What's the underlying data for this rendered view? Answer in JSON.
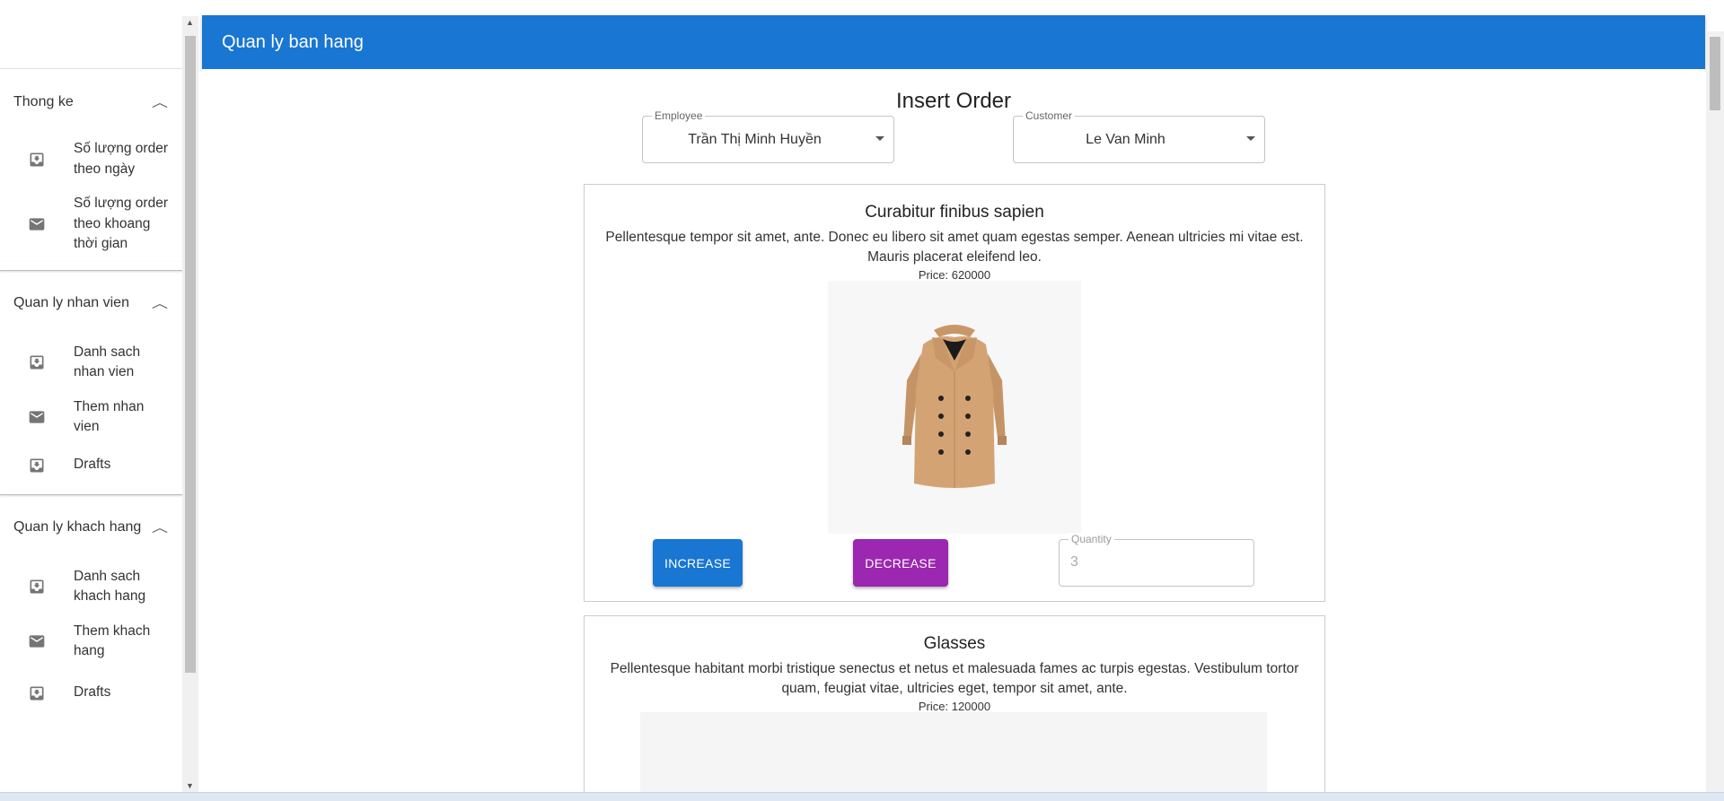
{
  "app": {
    "title": "Quan ly ban hang"
  },
  "sidebar": {
    "sections": [
      {
        "title": "Thong ke",
        "items": [
          {
            "label": "Số lượng order theo ngày",
            "icon": "move-to-inbox-icon"
          },
          {
            "label": "Số lượng order theo khoang thời gian",
            "icon": "mail-icon"
          }
        ]
      },
      {
        "title": "Quan ly nhan vien",
        "items": [
          {
            "label": "Danh sach nhan vien",
            "icon": "move-to-inbox-icon"
          },
          {
            "label": "Them nhan vien",
            "icon": "mail-icon"
          },
          {
            "label": "Drafts",
            "icon": "move-to-inbox-icon"
          }
        ]
      },
      {
        "title": "Quan ly khach hang",
        "items": [
          {
            "label": "Danh sach khach hang",
            "icon": "move-to-inbox-icon"
          },
          {
            "label": "Them khach hang",
            "icon": "mail-icon"
          },
          {
            "label": "Drafts",
            "icon": "move-to-inbox-icon"
          }
        ]
      }
    ]
  },
  "main": {
    "title": "Insert Order",
    "employee": {
      "label": "Employee",
      "value": "Trần Thị Minh Huyền"
    },
    "customer": {
      "label": "Customer",
      "value": "Le Van Minh"
    },
    "products": [
      {
        "name": "Curabitur finibus sapien",
        "description": "Pellentesque tempor sit amet, ante. Donec eu libero sit amet quam egestas semper. Aenean ultricies mi vitae est. Mauris placerat eleifend leo.",
        "price": "Price: 620000",
        "increase_label": "INCREASE",
        "decrease_label": "DECREASE",
        "quantity_label": "Quantity",
        "quantity_value": "3"
      },
      {
        "name": "Glasses",
        "description": "Pellentesque habitant morbi tristique senectus et netus et malesuada fames ac turpis egestas. Vestibulum tortor quam, feugiat vitae, ultricies eget, tempor sit amet, ante.",
        "price": "Price: 120000"
      }
    ]
  },
  "colors": {
    "primary": "#1976d2",
    "secondary": "#9c27b0"
  }
}
